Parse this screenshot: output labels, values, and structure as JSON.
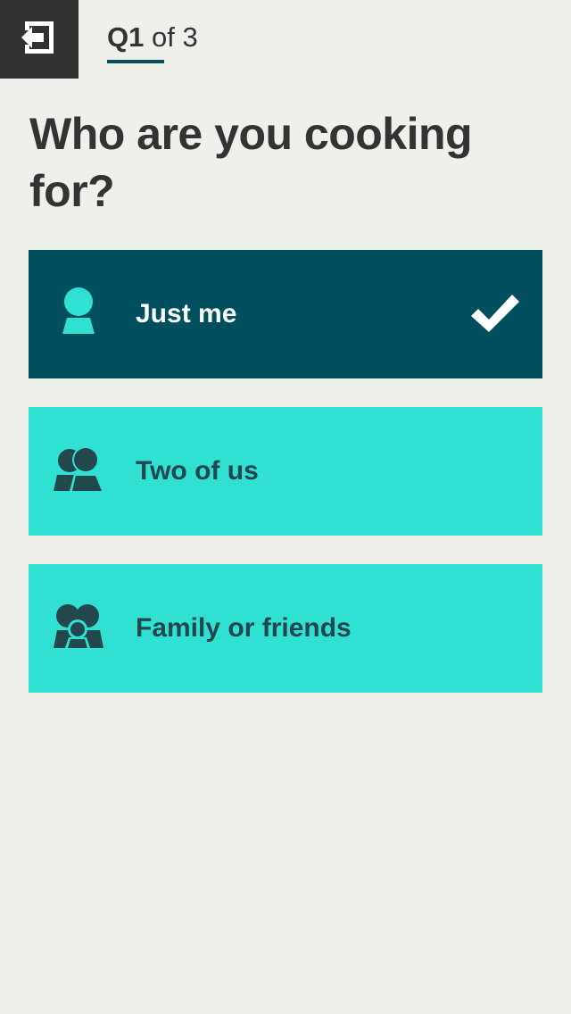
{
  "header": {
    "exit_icon": "exit-arrow-icon",
    "progress_current": "Q1",
    "progress_rest": "of 3"
  },
  "question": {
    "title": "Who are you cooking for?"
  },
  "options": [
    {
      "label": "Just me",
      "icon": "single-person-icon",
      "selected": true
    },
    {
      "label": "Two of us",
      "icon": "two-people-icon",
      "selected": false
    },
    {
      "label": "Family or friends",
      "icon": "group-people-icon",
      "selected": false
    }
  ],
  "colors": {
    "background": "#efefec",
    "header_button": "#323232",
    "accent_dark": "#004f5e",
    "accent_light": "#30e0d3",
    "text_dark": "#333333"
  }
}
